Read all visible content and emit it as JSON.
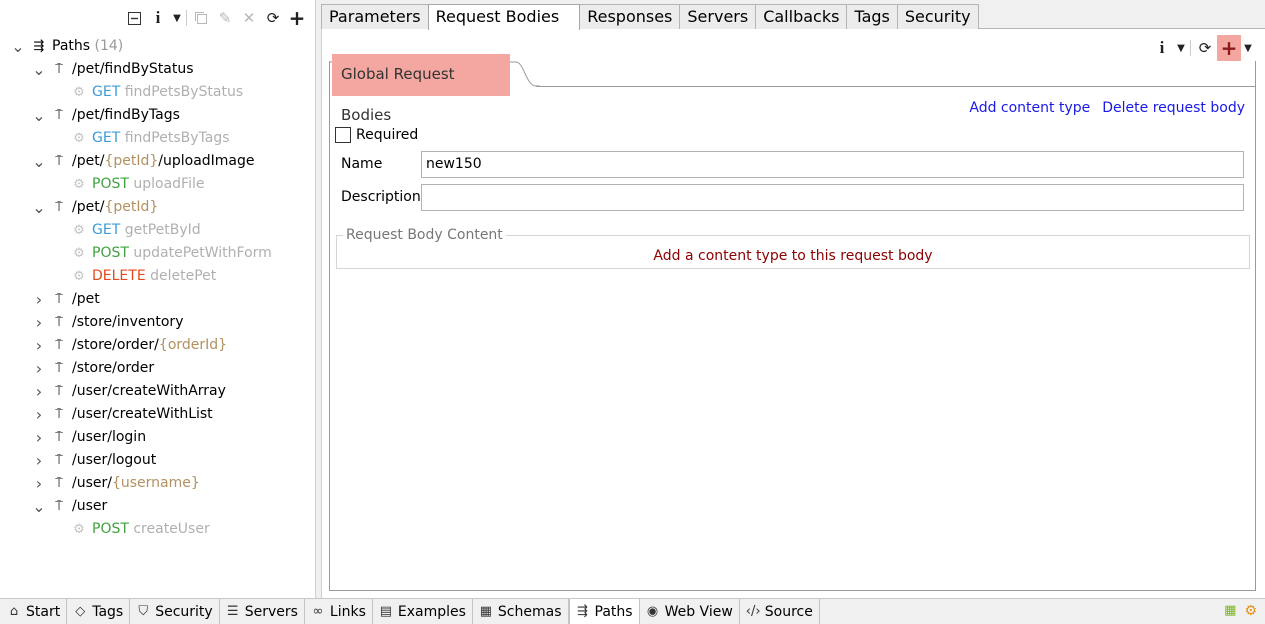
{
  "left_toolbar": {
    "collapse_icon": "collapse-all-icon",
    "info_icon": "info-icon",
    "dropdown_icon": "chevron-down-icon",
    "copy_icon": "copy-icon",
    "edit_icon": "pencil-icon",
    "delete_icon": "close-icon",
    "refresh_icon": "refresh-icon",
    "add_icon": "plus-icon"
  },
  "tree": {
    "root_label": "Paths",
    "root_count": "(14)",
    "nodes": [
      {
        "path_pre": "/pet/findByStatus",
        "param": "",
        "path_post": "",
        "expanded": true,
        "ops": [
          {
            "method": "GET",
            "name": "findPetsByStatus",
            "kind": "get"
          }
        ]
      },
      {
        "path_pre": "/pet/findByTags",
        "param": "",
        "path_post": "",
        "expanded": true,
        "ops": [
          {
            "method": "GET",
            "name": "findPetsByTags",
            "kind": "get"
          }
        ]
      },
      {
        "path_pre": "/pet/",
        "param": "{petId}",
        "path_post": "/uploadImage",
        "expanded": true,
        "ops": [
          {
            "method": "POST",
            "name": "uploadFile",
            "kind": "post"
          }
        ]
      },
      {
        "path_pre": "/pet/",
        "param": "{petId}",
        "path_post": "",
        "expanded": true,
        "ops": [
          {
            "method": "GET",
            "name": "getPetById",
            "kind": "get"
          },
          {
            "method": "POST",
            "name": "updatePetWithForm",
            "kind": "post"
          },
          {
            "method": "DELETE",
            "name": "deletePet",
            "kind": "del"
          }
        ]
      },
      {
        "path_pre": "/pet",
        "param": "",
        "path_post": "",
        "expanded": false,
        "ops": []
      },
      {
        "path_pre": "/store/inventory",
        "param": "",
        "path_post": "",
        "expanded": false,
        "ops": []
      },
      {
        "path_pre": "/store/order/",
        "param": "{orderId}",
        "path_post": "",
        "expanded": false,
        "ops": []
      },
      {
        "path_pre": "/store/order",
        "param": "",
        "path_post": "",
        "expanded": false,
        "ops": []
      },
      {
        "path_pre": "/user/createWithArray",
        "param": "",
        "path_post": "",
        "expanded": false,
        "ops": []
      },
      {
        "path_pre": "/user/createWithList",
        "param": "",
        "path_post": "",
        "expanded": false,
        "ops": []
      },
      {
        "path_pre": "/user/login",
        "param": "",
        "path_post": "",
        "expanded": false,
        "ops": []
      },
      {
        "path_pre": "/user/logout",
        "param": "",
        "path_post": "",
        "expanded": false,
        "ops": []
      },
      {
        "path_pre": "/user/",
        "param": "{username}",
        "path_post": "",
        "expanded": false,
        "ops": []
      },
      {
        "path_pre": "/user",
        "param": "",
        "path_post": "",
        "expanded": true,
        "ops": [
          {
            "method": "POST",
            "name": "createUser",
            "kind": "post"
          }
        ]
      }
    ]
  },
  "top_tabs": [
    {
      "label": "Parameters",
      "active": false
    },
    {
      "label": "Request Bodies",
      "active": true
    },
    {
      "label": "Responses",
      "active": false
    },
    {
      "label": "Servers",
      "active": false
    },
    {
      "label": "Callbacks",
      "active": false
    },
    {
      "label": "Tags",
      "active": false
    },
    {
      "label": "Security",
      "active": false
    }
  ],
  "section": {
    "title": "Global Request Bodies",
    "add_content_type": "Add content type",
    "delete_request_body": "Delete request body",
    "required_label": "Required",
    "name_label": "Name",
    "name_value": "new150",
    "description_label": "Description",
    "description_value": "",
    "rbc_legend": "Request Body Content",
    "rbc_message": "Add a content type to this request body"
  },
  "bottom_tabs": [
    {
      "label": "Start",
      "icon": "home-icon",
      "glyph": "⌂",
      "active": false
    },
    {
      "label": "Tags",
      "icon": "tag-icon",
      "glyph": "◇",
      "active": false
    },
    {
      "label": "Security",
      "icon": "shield-icon",
      "glyph": "⛉",
      "active": false
    },
    {
      "label": "Servers",
      "icon": "server-icon",
      "glyph": "☰",
      "active": false
    },
    {
      "label": "Links",
      "icon": "link-icon",
      "glyph": "∞",
      "active": false
    },
    {
      "label": "Examples",
      "icon": "examples-icon",
      "glyph": "▤",
      "active": false
    },
    {
      "label": "Schemas",
      "icon": "schemas-icon",
      "glyph": "▦",
      "active": false
    },
    {
      "label": "Paths",
      "icon": "paths-icon",
      "glyph": "⇶",
      "active": true
    },
    {
      "label": "Web View",
      "icon": "globe-icon",
      "glyph": "◉",
      "active": false
    },
    {
      "label": "Source",
      "icon": "code-icon",
      "glyph": "‹/›",
      "active": false
    }
  ],
  "colors": {
    "highlight": "#f4a6a1",
    "link": "#1a1ae6",
    "get": "#3d9bd6",
    "post": "#3fa13f",
    "delete": "#e04a1e",
    "param": "#b39060",
    "message": "#8b0000"
  }
}
